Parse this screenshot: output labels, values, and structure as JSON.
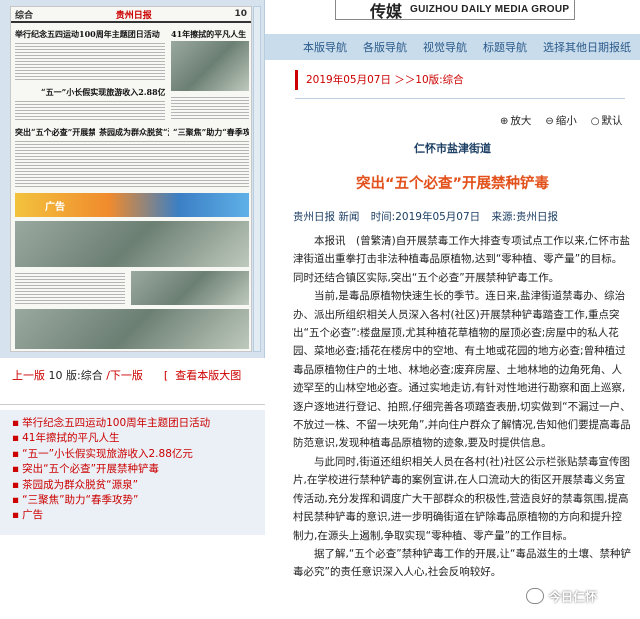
{
  "thumbnail": {
    "masthead_logo": "贵州日报",
    "masthead_page": "10",
    "masthead_section": "综合",
    "headline_1": "举行纪念五四运动100周年主题团日活动",
    "headline_2": "41年擦拭的平凡人生",
    "headline_3": "“五一”小长假实现旅游收入2.88亿元",
    "headline_4": "突出“五个必查”开展禁种铲毒",
    "headline_5": "茶园成为群众脱贫“源泉”",
    "headline_6": "“三聚焦”助力“春季攻势”",
    "ad_banner": "广告"
  },
  "page_nav": {
    "prev": "上一版",
    "current": "10 版:综合",
    "next": "下一版",
    "view_large": "查看本版大图"
  },
  "article_list": [
    "举行纪念五四运动100周年主题团日活动",
    "41年擦拭的平凡人生",
    "“五一”小长假实现旅游收入2.88亿元",
    "突出“五个必查”开展禁种铲毒",
    "茶园成为群众脱贫“源泉”",
    "“三聚焦”助力“春季攻势”",
    "广告"
  ],
  "logo": {
    "cn": "传媒",
    "en": "GUIZHOU DAILY MEDIA GROUP"
  },
  "nav": [
    "本版导航",
    "各版导航",
    "视觉导航",
    "标题导航",
    "选择其他日期报纸"
  ],
  "breadcrumb": "2019年05月07日 ＞＞10版:综合",
  "zoom": {
    "enlarge": "放大",
    "shrink": "缩小",
    "default": "默认"
  },
  "article": {
    "subtitle": "仁怀市盐津街道",
    "title": "突出“五个必查”开展禁种铲毒",
    "meta_source": "贵州日报 新闻",
    "meta_time": "时间:2019年05月07日",
    "meta_from": "来源:贵州日报",
    "paragraphs": [
      "本报讯　(曾繁清)自开展禁毒工作大排查专项试点工作以来,仁怀市盐津街道出重拳打击非法种植毒品原植物,达到“零种植、零产量”的目标。同时还结合镇区实际,突出“五个必查”开展禁种铲毒工作。",
      "当前,是毒品原植物快速生长的季节。连日来,盐津街道禁毒办、综治办、派出所组织相关人员深入各村(社区)开展禁种铲毒踏查工作,重点突出“五个必查”:楼盘屋顶,尤其种植花草植物的屋顶必查;房屋中的私人花园、菜地必查;插花在楼房中的空地、有土地或花园的地方必查;曾种植过毒品原植物住户的土地、林地必查;废弃房屋、土地林地的边角死角、人迹罕至的山林空地必查。通过实地走访,有针对性地进行勘察和面上巡察,逐户逐地进行登记、拍照,仔细完善各项踏查表册,切实做到“不漏过一户、不放过一株、不留一块死角”,并向住户群众了解情况,告知他们要提高毒品防范意识,发现种植毒品原植物的迹象,要及时提供信息。",
      "与此同时,街道还组织相关人员在各村(社)社区公示栏张贴禁毒宣传图片,在学校进行禁种铲毒的案例宣讲,在人口流动大的街区开展禁毒义务宣传活动,充分发挥和调度广大干部群众的积极性,营造良好的禁毒氛围,提高村民禁种铲毒的意识,进一步明确街道在铲除毒品原植物的方向和提升控制力,在源头上遏制,争取实现“零种植、零产量”的工作目标。",
      "据了解,“五个必查”禁种铲毒工作的开展,让“毒品滋生的土壤、禁种铲毒必究”的责任意识深入人心,社会反响较好。"
    ]
  },
  "watermark": "今日仁怀"
}
